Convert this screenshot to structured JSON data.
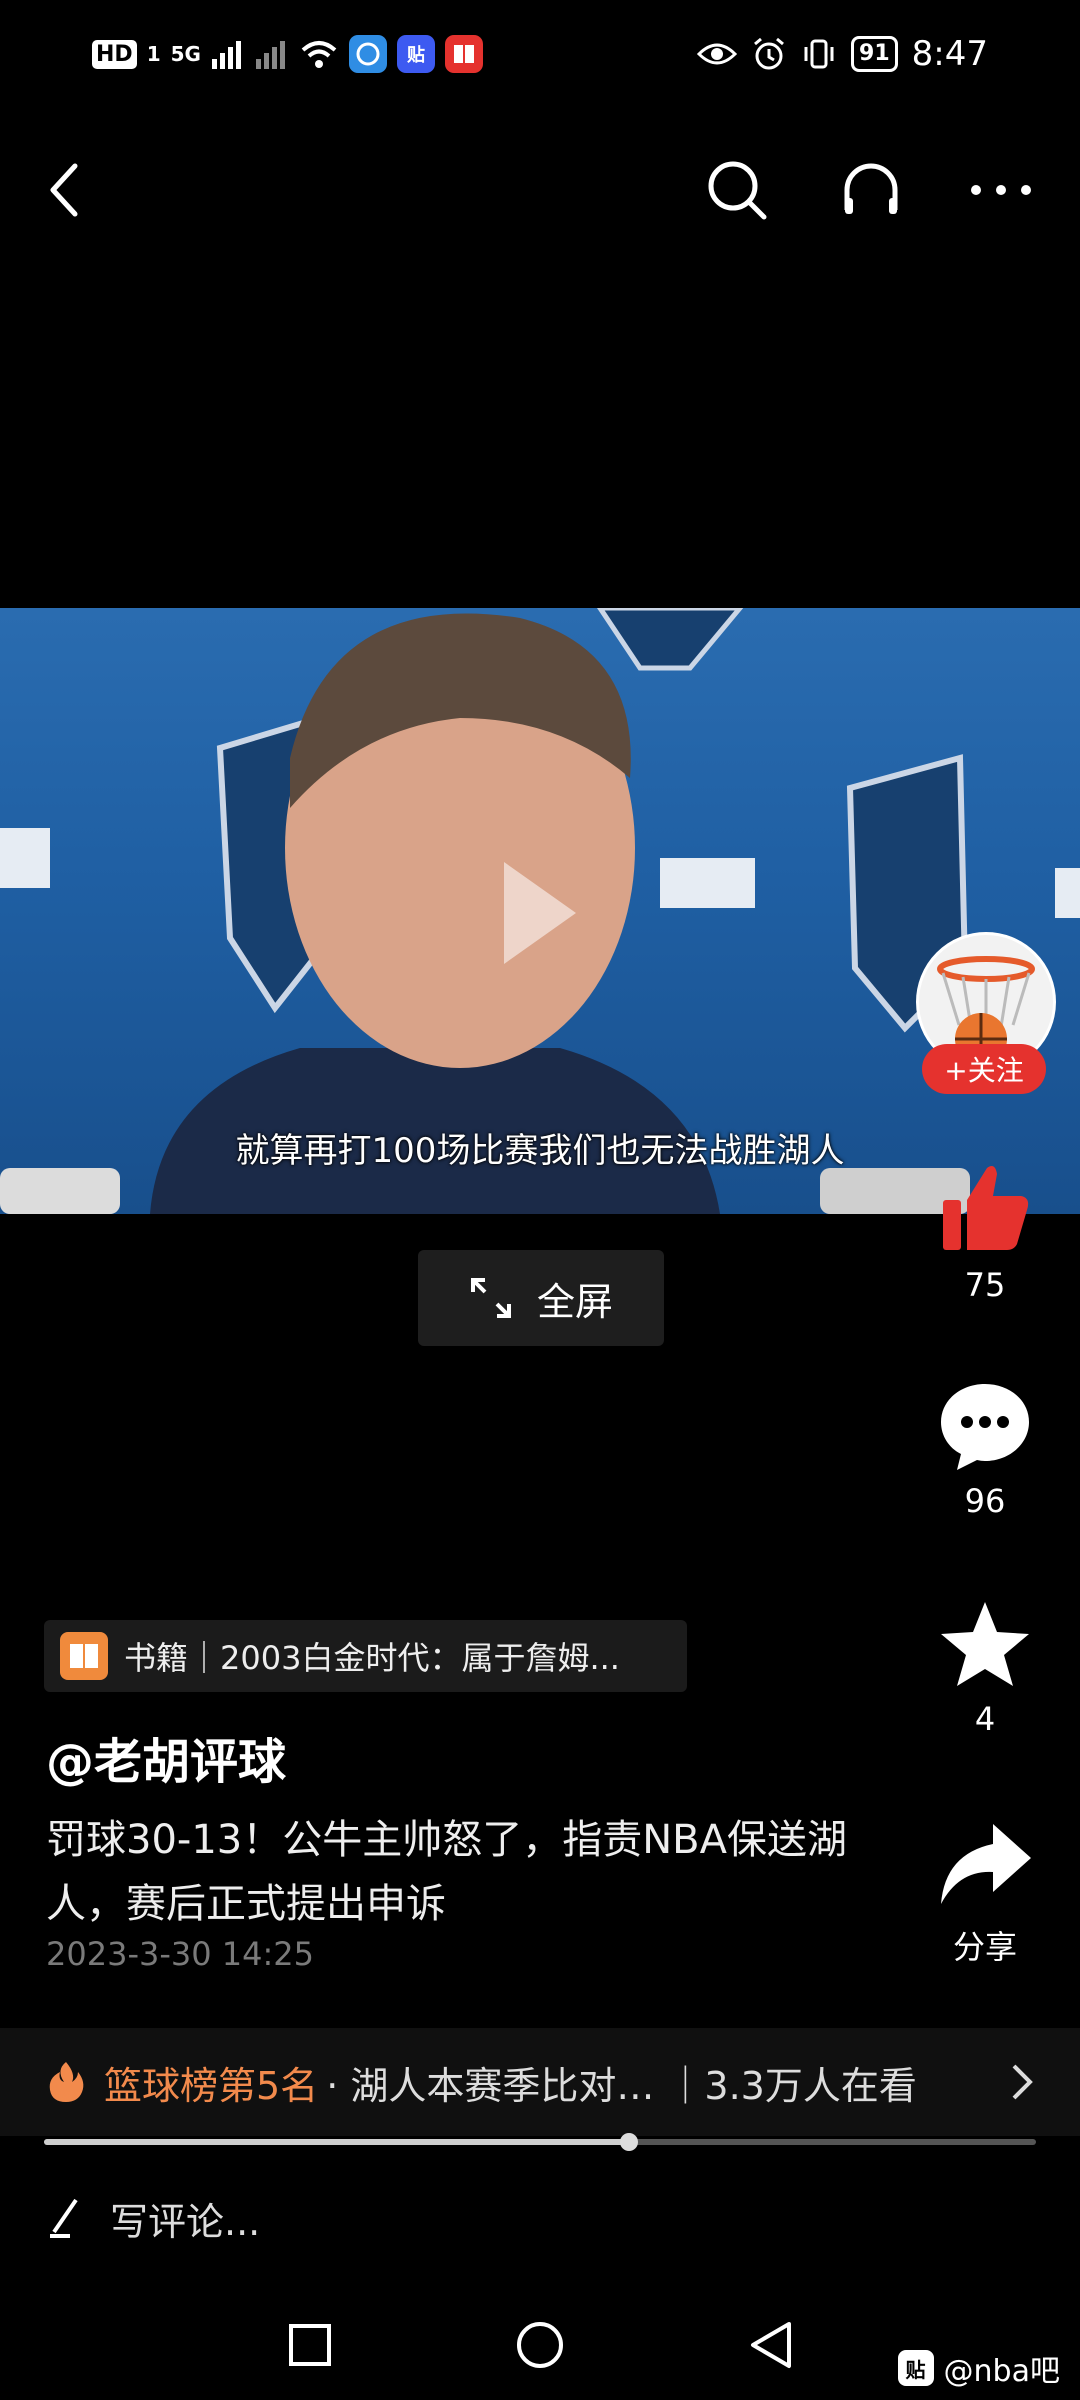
{
  "status_bar": {
    "hd": "HD",
    "sim1": "1",
    "network": "5G",
    "time": "8:47",
    "battery": "91",
    "app_badge": "贴"
  },
  "video": {
    "subtitle": "就算再打100场比赛我们也无法战胜湖人"
  },
  "follow": {
    "label": "+关注"
  },
  "actions": {
    "likes": "75",
    "comments": "96",
    "favorites": "4",
    "share_label": "分享"
  },
  "fullscreen": {
    "label": "全屏"
  },
  "post": {
    "book_tag": "书籍｜2003白金时代：属于詹姆...",
    "author": "@老胡评球",
    "title": "罚球30-13！公牛主帅怒了，指责NBA保送湖人，赛后正式提出申诉",
    "date": "2023-3-30 14:25"
  },
  "hot": {
    "rank": "篮球榜第5名",
    "rest": "· 湖人本赛季比对… ｜3.3万人在看"
  },
  "playback": {
    "progress": 0.59
  },
  "comment_input": {
    "placeholder": "写评论..."
  },
  "watermark": {
    "icon": "贴",
    "text": "@nba吧"
  },
  "colors": {
    "accent_red": "#e5322e",
    "hot_orange": "#f28a4c"
  }
}
